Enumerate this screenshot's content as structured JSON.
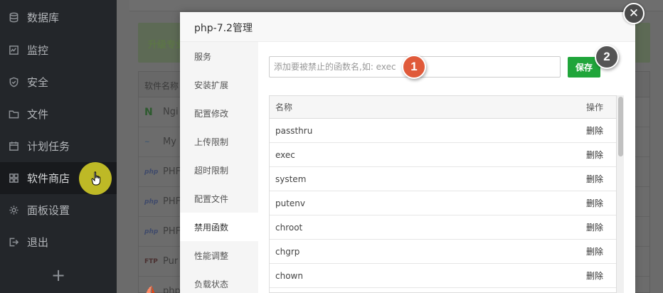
{
  "sidebar": {
    "items": [
      {
        "label": "数据库",
        "icon": "database-icon"
      },
      {
        "label": "监控",
        "icon": "monitor-icon"
      },
      {
        "label": "安全",
        "icon": "shield-icon"
      },
      {
        "label": "文件",
        "icon": "folder-icon"
      },
      {
        "label": "计划任务",
        "icon": "calendar-icon"
      },
      {
        "label": "软件商店",
        "icon": "grid-icon"
      },
      {
        "label": "面板设置",
        "icon": "gear-icon"
      },
      {
        "label": "退出",
        "icon": "logout-icon"
      }
    ],
    "active": "软件商店",
    "add_label": "+"
  },
  "background": {
    "banner_text": "升级专业",
    "table_header": "软件名称",
    "rows": [
      {
        "icon": "nginx-icon",
        "badge": "N",
        "label": "Ngi"
      },
      {
        "icon": "mysql-icon",
        "badge": "~",
        "label": "My"
      },
      {
        "icon": "php-icon",
        "badge": "php",
        "label": "PHF"
      },
      {
        "icon": "php-icon",
        "badge": "php",
        "label": "PHF"
      },
      {
        "icon": "php-icon",
        "badge": "php",
        "label": "PHF"
      },
      {
        "icon": "ftp-icon",
        "badge": "FTP",
        "label": "Pur"
      },
      {
        "icon": "apache-icon",
        "badge": "⛵",
        "label": "php"
      }
    ]
  },
  "modal": {
    "title": "php-7.2管理",
    "close_label": "✕",
    "nav": [
      {
        "label": "服务"
      },
      {
        "label": "安装扩展"
      },
      {
        "label": "配置修改"
      },
      {
        "label": "上传限制"
      },
      {
        "label": "超时限制"
      },
      {
        "label": "配置文件"
      },
      {
        "label": "禁用函数"
      },
      {
        "label": "性能调整"
      },
      {
        "label": "负载状态"
      }
    ],
    "active_nav": "禁用函数",
    "input_placeholder": "添加要被禁止的函数名,如: exec",
    "input_value": "",
    "save_label": "保存",
    "badge_1": "1",
    "badge_2": "2",
    "table": {
      "columns": [
        "名称",
        "操作"
      ],
      "rows": [
        {
          "name": "passthru",
          "action": "删除"
        },
        {
          "name": "exec",
          "action": "删除"
        },
        {
          "name": "system",
          "action": "删除"
        },
        {
          "name": "putenv",
          "action": "删除"
        },
        {
          "name": "chroot",
          "action": "删除"
        },
        {
          "name": "chgrp",
          "action": "删除"
        },
        {
          "name": "chown",
          "action": "删除"
        }
      ]
    }
  },
  "colors": {
    "sidebar_bg": "#23262a",
    "accent_green": "#20a53a",
    "badge_1": "#e05a3a",
    "badge_2": "#555555",
    "cursor_highlight": "#dcd628"
  }
}
